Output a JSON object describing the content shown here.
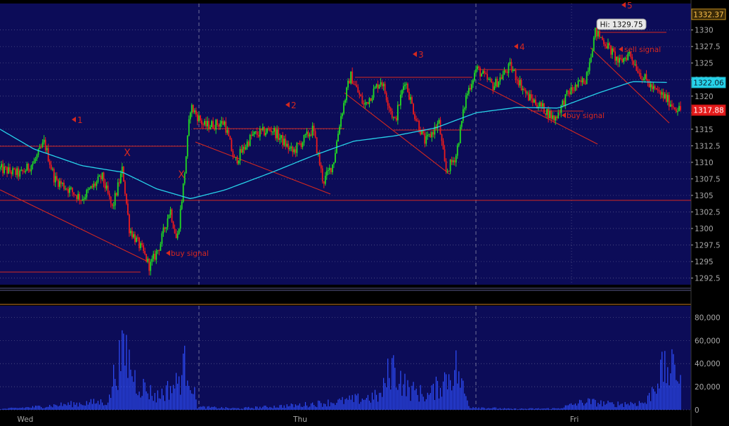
{
  "chart_data": [
    {
      "type": "candlestick",
      "panel": "price",
      "y_axis": {
        "range": [
          1291.5,
          1334
        ],
        "ticks": [
          1292.5,
          1295,
          1297.5,
          1300,
          1302.5,
          1305,
          1307.5,
          1310,
          1312.5,
          1315,
          1317.5,
          1320,
          1322.5,
          1325,
          1327.5,
          1330
        ],
        "tick_labels": [
          "1292.5",
          "1295",
          "1297.5",
          "1300",
          "1302.5",
          "1305",
          "1307.5",
          "1310",
          "1312.5",
          "1315",
          "1317.5",
          "1320",
          "1322.5",
          "1325",
          "1327.5",
          "1330"
        ],
        "side": "right"
      },
      "x_axis": {
        "days": [
          "Wed",
          "Thu",
          "Fri"
        ]
      },
      "grid": true,
      "price_path": [
        {
          "t": 0.0,
          "p": 1309.0
        },
        {
          "t": 0.03,
          "p": 1308.2
        },
        {
          "t": 0.05,
          "p": 1310.0
        },
        {
          "t": 0.065,
          "p": 1313.0
        },
        {
          "t": 0.08,
          "p": 1307.5
        },
        {
          "t": 0.12,
          "p": 1304.5
        },
        {
          "t": 0.15,
          "p": 1307.8
        },
        {
          "t": 0.165,
          "p": 1303.0
        },
        {
          "t": 0.18,
          "p": 1309.0
        },
        {
          "t": 0.19,
          "p": 1300.0
        },
        {
          "t": 0.21,
          "p": 1296.5
        },
        {
          "t": 0.22,
          "p": 1294.2
        },
        {
          "t": 0.235,
          "p": 1297.5
        },
        {
          "t": 0.25,
          "p": 1303.0
        },
        {
          "t": 0.26,
          "p": 1298.0
        },
        {
          "t": 0.27,
          "p": 1307.0
        },
        {
          "t": 0.28,
          "p": 1318.5
        },
        {
          "t": 0.3,
          "p": 1315.5
        },
        {
          "t": 0.33,
          "p": 1316.0
        },
        {
          "t": 0.345,
          "p": 1310.0
        },
        {
          "t": 0.37,
          "p": 1314.0
        },
        {
          "t": 0.4,
          "p": 1315.0
        },
        {
          "t": 0.43,
          "p": 1311.5
        },
        {
          "t": 0.46,
          "p": 1315.0
        },
        {
          "t": 0.475,
          "p": 1307.0
        },
        {
          "t": 0.49,
          "p": 1310.0
        },
        {
          "t": 0.5,
          "p": 1316.5
        },
        {
          "t": 0.515,
          "p": 1323.2
        },
        {
          "t": 0.535,
          "p": 1318.5
        },
        {
          "t": 0.56,
          "p": 1322.5
        },
        {
          "t": 0.58,
          "p": 1316.0
        },
        {
          "t": 0.595,
          "p": 1322.5
        },
        {
          "t": 0.61,
          "p": 1317.0
        },
        {
          "t": 0.625,
          "p": 1313.0
        },
        {
          "t": 0.645,
          "p": 1316.0
        },
        {
          "t": 0.655,
          "p": 1308.5
        },
        {
          "t": 0.67,
          "p": 1311.0
        },
        {
          "t": 0.685,
          "p": 1320.0
        },
        {
          "t": 0.7,
          "p": 1324.2
        },
        {
          "t": 0.725,
          "p": 1321.5
        },
        {
          "t": 0.75,
          "p": 1324.5
        },
        {
          "t": 0.775,
          "p": 1320.0
        },
        {
          "t": 0.8,
          "p": 1318.0
        },
        {
          "t": 0.815,
          "p": 1316.5
        },
        {
          "t": 0.835,
          "p": 1320.5
        },
        {
          "t": 0.86,
          "p": 1322.5
        },
        {
          "t": 0.875,
          "p": 1329.75
        },
        {
          "t": 0.89,
          "p": 1328.0
        },
        {
          "t": 0.91,
          "p": 1325.0
        },
        {
          "t": 0.925,
          "p": 1326.5
        },
        {
          "t": 0.94,
          "p": 1323.5
        },
        {
          "t": 0.96,
          "p": 1321.0
        },
        {
          "t": 0.975,
          "p": 1320.0
        },
        {
          "t": 0.99,
          "p": 1318.5
        },
        {
          "t": 1.0,
          "p": 1317.88
        }
      ],
      "moving_average": [
        {
          "t": 0.0,
          "p": 1315.0
        },
        {
          "t": 0.05,
          "p": 1312.0
        },
        {
          "t": 0.12,
          "p": 1309.5
        },
        {
          "t": 0.18,
          "p": 1308.5
        },
        {
          "t": 0.23,
          "p": 1306.0
        },
        {
          "t": 0.28,
          "p": 1304.5
        },
        {
          "t": 0.33,
          "p": 1305.8
        },
        {
          "t": 0.4,
          "p": 1308.5
        },
        {
          "t": 0.46,
          "p": 1311.0
        },
        {
          "t": 0.52,
          "p": 1313.2
        },
        {
          "t": 0.58,
          "p": 1314.0
        },
        {
          "t": 0.64,
          "p": 1315.2
        },
        {
          "t": 0.7,
          "p": 1317.5
        },
        {
          "t": 0.76,
          "p": 1318.3
        },
        {
          "t": 0.82,
          "p": 1318.2
        },
        {
          "t": 0.88,
          "p": 1320.5
        },
        {
          "t": 0.93,
          "p": 1322.2
        },
        {
          "t": 0.98,
          "p": 1322.06
        }
      ],
      "badges": {
        "top": "1332.37",
        "moving_average": "1322.06",
        "last": "1317.88"
      },
      "badge_values": {
        "top": 1332.37,
        "moving_average": 1322.06,
        "last": 1317.88
      },
      "hi_label": "Hi: 1329.75",
      "hi_value": 1329.75,
      "markers": [
        "1",
        "2",
        "3",
        "4",
        "5"
      ],
      "annotations": [
        "buy signal",
        "buy signal",
        "sell signal"
      ],
      "x_marks": [
        "X",
        "X"
      ],
      "colors": {
        "up": "#22dd22",
        "down": "#ee1c1c",
        "moving_average": "#27d3ea",
        "trendline": "#d4281f",
        "background": "#0c0c58",
        "grid": "#5a5a8c",
        "volume": "#2f4fff",
        "axis_text": "#a8a8a8"
      }
    },
    {
      "type": "bar",
      "panel": "volume",
      "y_axis": {
        "range": [
          0,
          90000
        ],
        "ticks": [
          0,
          20000,
          40000,
          60000,
          80000
        ],
        "tick_labels": [
          "0",
          "20,000",
          "40,000",
          "60,000",
          "80,000"
        ],
        "side": "right"
      },
      "volume_profile": [
        {
          "t": 0.0,
          "v": 800
        },
        {
          "t": 0.05,
          "v": 3000
        },
        {
          "t": 0.1,
          "v": 6000
        },
        {
          "t": 0.16,
          "v": 9000
        },
        {
          "t": 0.17,
          "v": 45000
        },
        {
          "t": 0.185,
          "v": 62000
        },
        {
          "t": 0.2,
          "v": 30000
        },
        {
          "t": 0.23,
          "v": 14000
        },
        {
          "t": 0.26,
          "v": 28000
        },
        {
          "t": 0.275,
          "v": 52000
        },
        {
          "t": 0.29,
          "v": 3000
        },
        {
          "t": 0.35,
          "v": 1500
        },
        {
          "t": 0.44,
          "v": 5000
        },
        {
          "t": 0.5,
          "v": 9000
        },
        {
          "t": 0.56,
          "v": 15000
        },
        {
          "t": 0.575,
          "v": 48000
        },
        {
          "t": 0.6,
          "v": 22000
        },
        {
          "t": 0.63,
          "v": 15000
        },
        {
          "t": 0.67,
          "v": 45000
        },
        {
          "t": 0.69,
          "v": 3000
        },
        {
          "t": 0.75,
          "v": 1000
        },
        {
          "t": 0.82,
          "v": 1500
        },
        {
          "t": 0.86,
          "v": 9000
        },
        {
          "t": 0.9,
          "v": 6000
        },
        {
          "t": 0.95,
          "v": 8000
        },
        {
          "t": 0.97,
          "v": 40000
        },
        {
          "t": 0.98,
          "v": 42000
        }
      ]
    }
  ]
}
